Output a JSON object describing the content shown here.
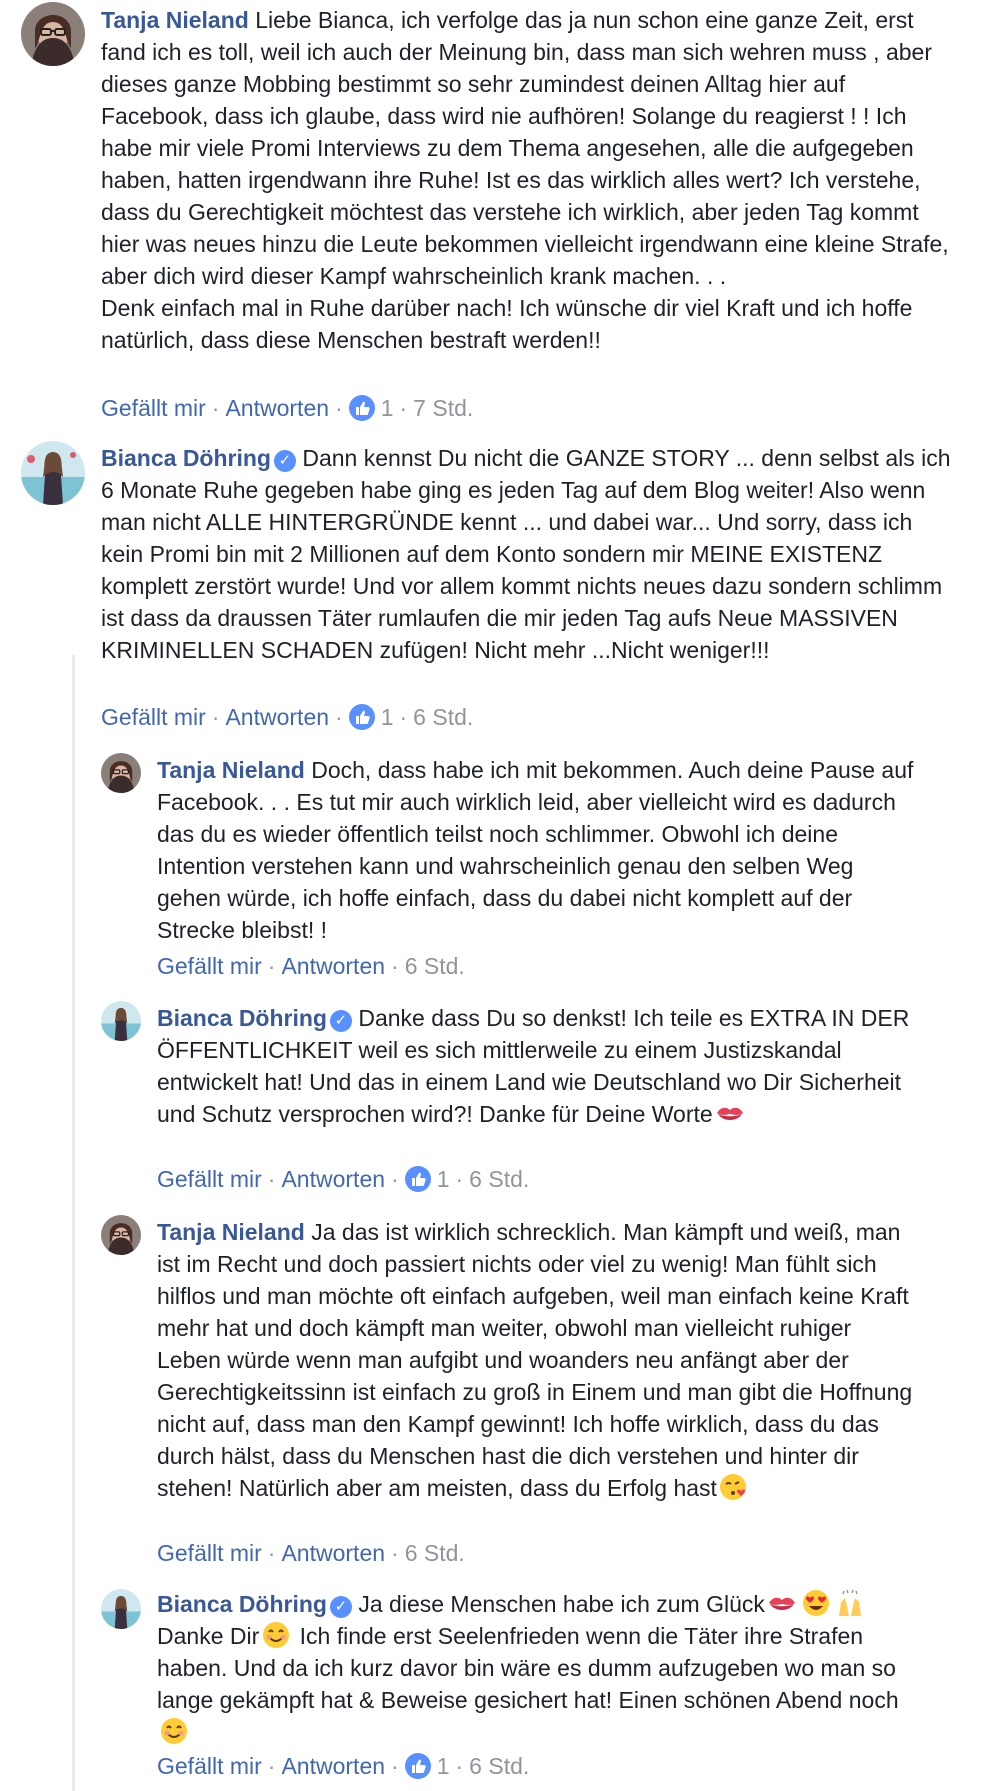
{
  "comments": [
    {
      "author": "Tanja Nieland",
      "verified": false,
      "text": "Liebe Bianca, ich verfolge das ja nun schon eine ganze Zeit, erst fand ich es toll, weil ich auch der Meinung bin, dass man sich wehren muss , aber dieses ganze Mobbing bestimmt so sehr zumindest deinen Alltag hier auf Facebook, dass ich glaube, dass wird nie aufhören! Solange du reagierst ! ! Ich habe mir viele Promi Interviews zu dem Thema angesehen, alle die aufgegeben haben, hatten irgendwann ihre Ruhe! Ist es das wirklich alles wert? Ich verstehe, dass du Gerechtigkeit möchtest das verstehe ich wirklich, aber jeden Tag kommt hier was neues hinzu die Leute bekommen vielleicht irgendwann eine kleine Strafe, aber dich wird dieser Kampf wahrscheinlich krank machen. . .\nDenk einfach mal in Ruhe darüber nach! Ich wünsche dir viel Kraft und ich hoffe natürlich, dass diese Menschen bestraft werden!!",
      "like_label": "Gefällt mir",
      "reply_label": "Antworten",
      "reactions": "1",
      "time": "7 Std."
    },
    {
      "author": "Bianca Döhring",
      "verified": true,
      "text": "Dann kennst Du nicht die GANZE STORY ... denn selbst als ich 6 Monate Ruhe gegeben habe ging es jeden Tag auf dem Blog weiter! Also wenn man nicht ALLE HINTERGRÜNDE kennt ... und dabei war... Und sorry, dass ich kein Promi bin mit 2 Millionen auf dem Konto sondern mir MEINE EXISTENZ komplett zerstört wurde! Und vor allem kommt nichts neues dazu sondern schlimm ist dass da draussen Täter rumlaufen die mir jeden Tag aufs Neue MASSIVEN KRIMINELLEN SCHADEN zufügen! Nicht mehr ...Nicht weniger!!!",
      "like_label": "Gefällt mir",
      "reply_label": "Antworten",
      "reactions": "1",
      "time": "6 Std."
    }
  ],
  "replies": [
    {
      "author": "Tanja Nieland",
      "verified": false,
      "text": "Doch, dass habe ich mit bekommen. Auch deine Pause auf Facebook. . . Es tut mir auch wirklich leid, aber vielleicht wird es dadurch das du es wieder öffentlich teilst noch schlimmer. Obwohl ich deine Intention verstehen kann und wahrscheinlich genau den selben Weg gehen würde, ich hoffe einfach, dass du dabei nicht komplett auf der Strecke bleibst! !",
      "like_label": "Gefällt mir",
      "reply_label": "Antworten",
      "reactions": "",
      "time": "6 Std."
    },
    {
      "author": "Bianca Döhring",
      "verified": true,
      "text": "Danke dass Du so denkst! Ich teile es EXTRA IN DER ÖFFENTLICHKEIT weil es sich mittlerweile zu einem Justizskandal entwickelt hat! Und das in einem Land wie Deutschland wo Dir Sicherheit und Schutz versprochen wird?! Danke für Deine Worte",
      "like_label": "Gefällt mir",
      "reply_label": "Antworten",
      "reactions": "1",
      "time": "6 Std."
    },
    {
      "author": "Tanja Nieland",
      "verified": false,
      "text": "Ja das ist wirklich schrecklich. Man kämpft und weiß, man ist im Recht und doch passiert nichts oder viel zu wenig! Man fühlt sich hilflos und man möchte oft einfach aufgeben, weil man einfach keine Kraft mehr hat und doch kämpft man weiter, obwohl man vielleicht ruhiger Leben würde wenn man aufgibt und woanders neu anfängt aber der Gerechtigkeitssinn ist einfach zu groß in Einem und man gibt die Hoffnung nicht auf, dass man den Kampf gewinnt! Ich hoffe wirklich, dass du das durch hälst, dass du Menschen hast die dich verstehen und hinter dir stehen! Natürlich aber am meisten, dass du Erfolg hast",
      "like_label": "Gefällt mir",
      "reply_label": "Antworten",
      "reactions": "",
      "time": "6 Std."
    },
    {
      "author": "Bianca Döhring",
      "verified": true,
      "text_a": "Ja diese Menschen habe ich zum Glück",
      "text_b": "Danke Dir",
      "text_c": "Ich finde erst Seelenfrieden wenn die Täter ihre Strafen haben. Und da ich kurz davor bin wäre es dumm aufzugeben wo man so lange gekämpft hat & Beweise gesichert hat! Einen schönen Abend noch",
      "like_label": "Gefällt mir",
      "reply_label": "Antworten",
      "reactions": "1",
      "time": "6 Std."
    }
  ],
  "separator": "·",
  "colors": {
    "author": "#385898",
    "link": "#4267b2",
    "meta": "#90949c",
    "text": "#1d2129",
    "like": "#5890ff"
  },
  "icons": [
    "like-icon",
    "verified-badge-icon",
    "kiss-mark-emoji",
    "heart-eyes-emoji",
    "raised-hands-emoji",
    "smiling-face-emoji",
    "kissing-heart-emoji"
  ]
}
